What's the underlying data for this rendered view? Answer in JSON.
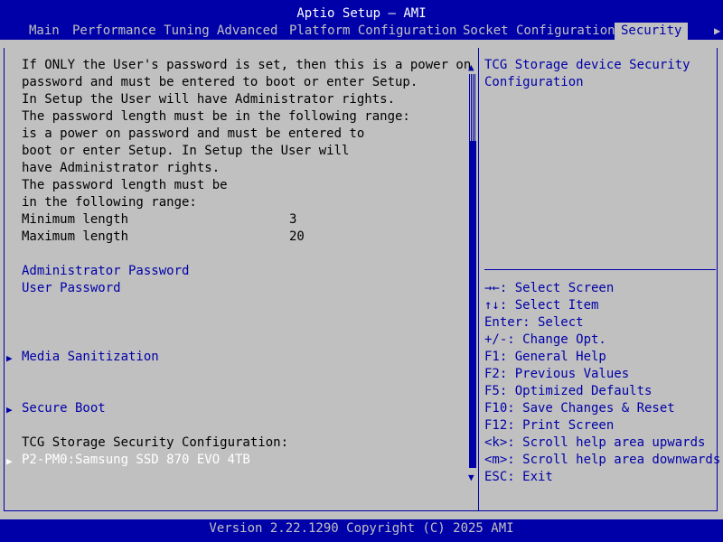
{
  "header": {
    "title": "Aptio Setup – AMI",
    "tabs": [
      {
        "label": "Main"
      },
      {
        "label": "Performance Tuning"
      },
      {
        "label": "Advanced"
      },
      {
        "label": "Platform Configuration"
      },
      {
        "label": "Socket Configuration"
      },
      {
        "label": "Security"
      }
    ],
    "active_tab": "Security",
    "more_tabs_icon": "triangle-right-icon"
  },
  "main": {
    "description_lines": [
      "If ONLY the User's password is set, then this is a power on",
      "password and must be entered to boot or enter Setup.",
      "In Setup the User will have Administrator rights.",
      "The password length must be in the following range:",
      "is a power on password and must be entered to",
      "boot or enter Setup. In Setup the User will",
      "have Administrator rights.",
      "The password length must be",
      "in the following range:"
    ],
    "min_length": {
      "label": "Minimum length",
      "value": "3"
    },
    "max_length": {
      "label": "Maximum length",
      "value": "20"
    },
    "admin_password": "Administrator Password",
    "user_password": "User Password",
    "media_sanitization": "Media Sanitization",
    "secure_boot": "Secure Boot",
    "tcg_heading": "TCG Storage Security Configuration:",
    "tcg_device": "P2-PM0:Samsung SSD 870 EVO 4TB"
  },
  "help": {
    "description_lines": [
      "TCG Storage device Security",
      "Configuration"
    ],
    "keys": [
      "→←: Select Screen",
      "↑↓: Select Item",
      "Enter: Select",
      "+/-: Change Opt.",
      "F1: General Help",
      "F2: Previous Values",
      "F5: Optimized Defaults",
      "F10: Save Changes & Reset",
      "F12: Print Screen",
      "<k>: Scroll help area upwards",
      "<m>: Scroll help area downwards",
      "ESC: Exit"
    ]
  },
  "footer": {
    "version": "Version 2.22.1290 Copyright (C) 2025 AMI"
  },
  "colors": {
    "background": "#c0c0c0",
    "accent": "#0000a8",
    "selected_text": "#ffffff"
  }
}
